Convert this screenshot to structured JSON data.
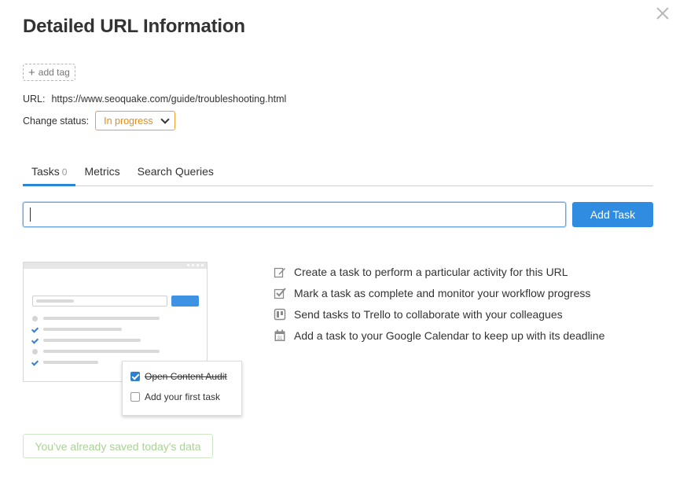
{
  "dialog": {
    "title": "Detailed URL Information",
    "close_icon": "close-icon"
  },
  "tag": {
    "icon": "plus-icon",
    "label": "add tag"
  },
  "url": {
    "label": "URL:",
    "value": "https://www.seoquake.com/guide/troubleshooting.html"
  },
  "status": {
    "label": "Change status:",
    "selected": "In progress",
    "icon": "chevron-down-icon",
    "accent_color": "#e98a0c"
  },
  "tabs": [
    {
      "label": "Tasks",
      "count": "0",
      "active": true
    },
    {
      "label": "Metrics"
    },
    {
      "label": "Search Queries"
    }
  ],
  "task_input": {
    "value": "",
    "placeholder": ""
  },
  "add_task_button": {
    "label": "Add Task",
    "color": "#2f8ce0"
  },
  "illustration": {
    "popup_items": [
      {
        "label": "Open Content Audit",
        "checked": true,
        "strikethrough": true
      },
      {
        "label": "Add your first task",
        "checked": false
      }
    ]
  },
  "features": [
    {
      "icon": "edit-icon",
      "text": "Create a task to perform a particular activity for this URL"
    },
    {
      "icon": "check-square-icon",
      "text": "Mark a task as complete and monitor your workflow progress"
    },
    {
      "icon": "trello-icon",
      "text": "Send tasks to Trello to collaborate with your colleagues"
    },
    {
      "icon": "calendar-icon",
      "text": "Add a task to your Google Calendar to keep up with its deadline"
    }
  ],
  "saved_button": {
    "label": "You've already saved today's data",
    "color": "#a9d394"
  }
}
